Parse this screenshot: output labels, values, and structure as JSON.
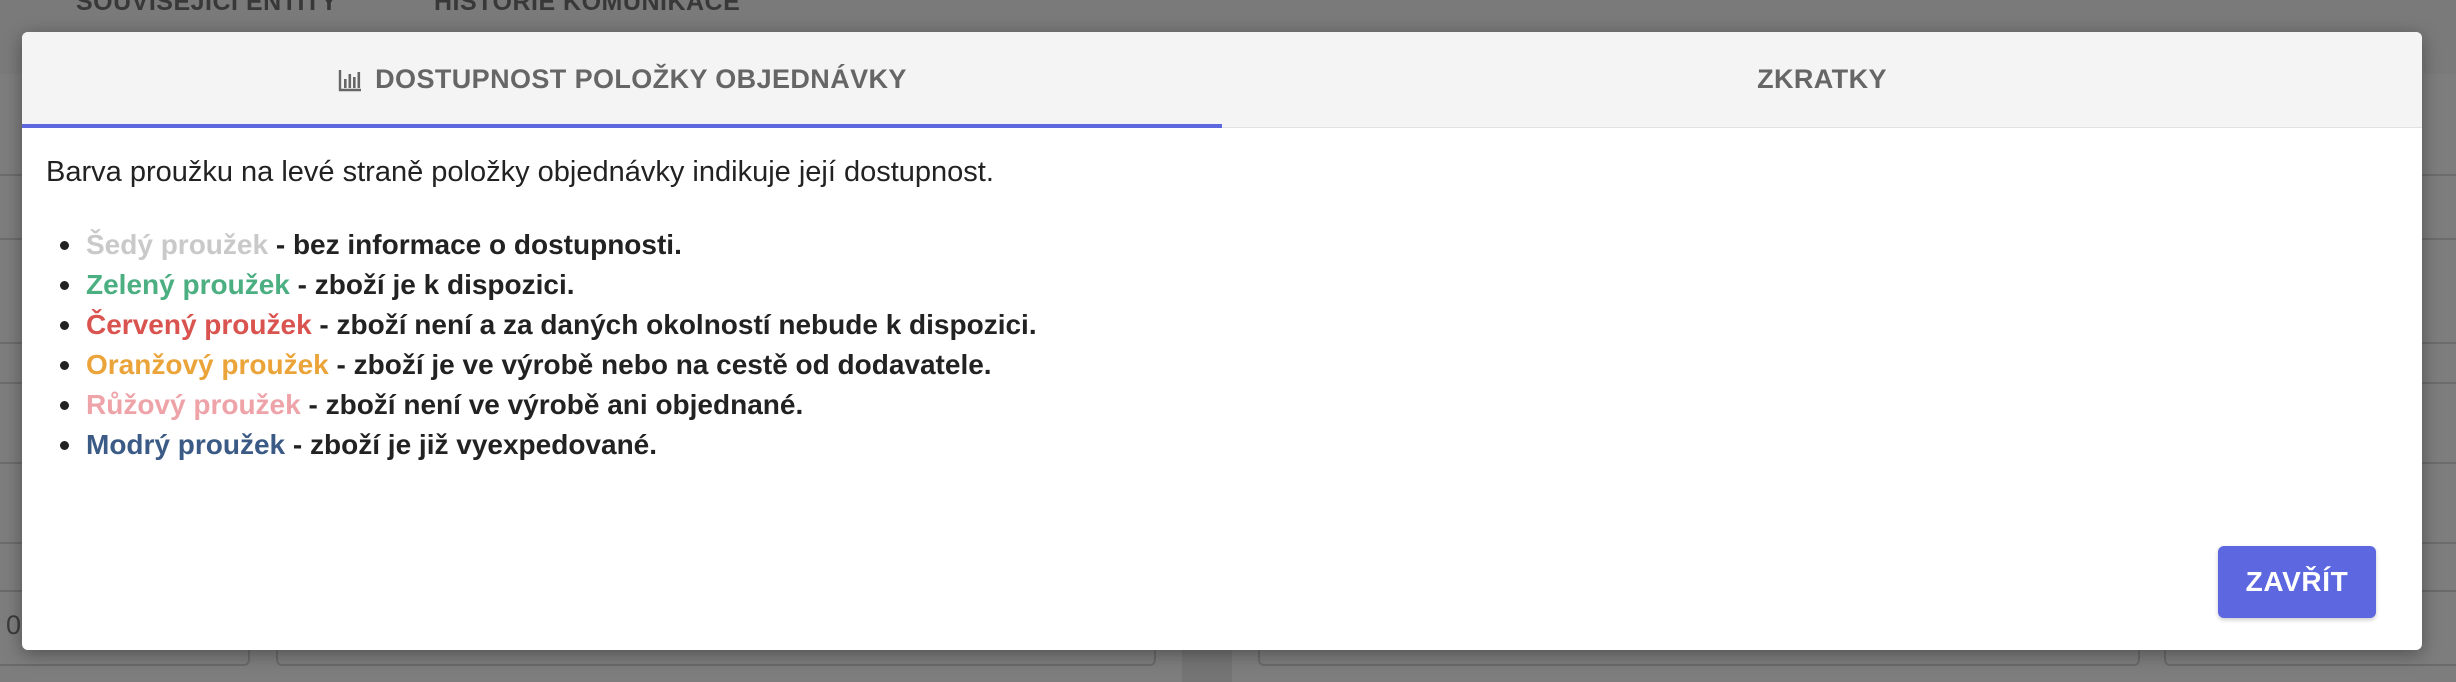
{
  "background": {
    "tabs": [
      "SOUVISEJÍCÍ ENTITY",
      "HISTORIE KOMUNIKACE"
    ],
    "partial_value": "0"
  },
  "modal": {
    "tabs": [
      {
        "label": "DOSTUPNOST POLOŽKY OBJEDNÁVKY",
        "icon": "bar-chart-icon",
        "active": true
      },
      {
        "label": "ZKRATKY",
        "active": false
      }
    ],
    "intro": "Barva proužku na levé straně položky objednávky indikuje její dostupnost.",
    "legend": [
      {
        "name": "Šedý proužek",
        "color": "#c9c9c9",
        "desc": " - bez informace o dostupnosti."
      },
      {
        "name": "Zelený proužek",
        "color": "#4caf82",
        "desc": " - zboží je k dispozici."
      },
      {
        "name": "Červený proužek",
        "color": "#d9534f",
        "desc": " - zboží není a za daných okolností nebude k dispozici."
      },
      {
        "name": "Oranžový proužek",
        "color": "#eba43a",
        "desc": " - zboží je ve výrobě nebo na cestě od dodavatele."
      },
      {
        "name": "Růžový proužek",
        "color": "#eea3a8",
        "desc": " - zboží není ve výrobě ani objednané."
      },
      {
        "name": "Modrý proužek",
        "color": "#3b5b86",
        "desc": " - zboží je již vyexpedované."
      }
    ],
    "close_label": "ZAVŘÍT"
  },
  "colors": {
    "accent": "#5c67e0",
    "overlay": "#7d7d7d"
  }
}
